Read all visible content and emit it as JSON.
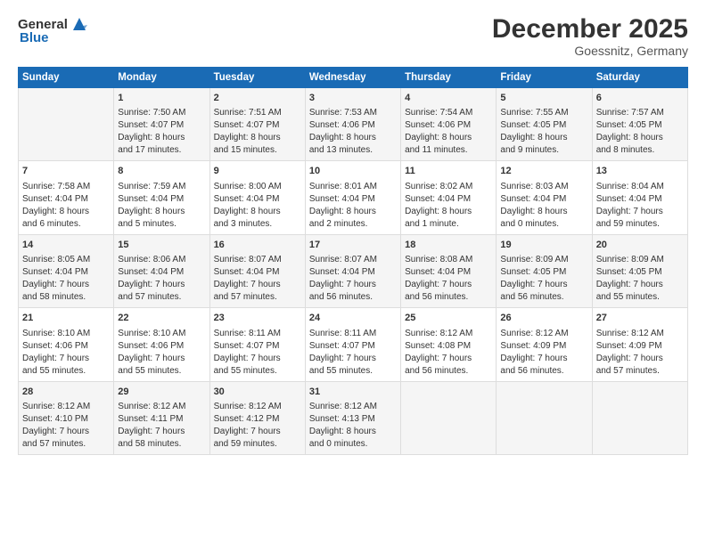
{
  "logo": {
    "general": "General",
    "blue": "Blue"
  },
  "title": "December 2025",
  "subtitle": "Goessnitz, Germany",
  "days_header": [
    "Sunday",
    "Monday",
    "Tuesday",
    "Wednesday",
    "Thursday",
    "Friday",
    "Saturday"
  ],
  "weeks": [
    [
      {
        "day": "",
        "content": ""
      },
      {
        "day": "1",
        "content": "Sunrise: 7:50 AM\nSunset: 4:07 PM\nDaylight: 8 hours\nand 17 minutes."
      },
      {
        "day": "2",
        "content": "Sunrise: 7:51 AM\nSunset: 4:07 PM\nDaylight: 8 hours\nand 15 minutes."
      },
      {
        "day": "3",
        "content": "Sunrise: 7:53 AM\nSunset: 4:06 PM\nDaylight: 8 hours\nand 13 minutes."
      },
      {
        "day": "4",
        "content": "Sunrise: 7:54 AM\nSunset: 4:06 PM\nDaylight: 8 hours\nand 11 minutes."
      },
      {
        "day": "5",
        "content": "Sunrise: 7:55 AM\nSunset: 4:05 PM\nDaylight: 8 hours\nand 9 minutes."
      },
      {
        "day": "6",
        "content": "Sunrise: 7:57 AM\nSunset: 4:05 PM\nDaylight: 8 hours\nand 8 minutes."
      }
    ],
    [
      {
        "day": "7",
        "content": "Sunrise: 7:58 AM\nSunset: 4:04 PM\nDaylight: 8 hours\nand 6 minutes."
      },
      {
        "day": "8",
        "content": "Sunrise: 7:59 AM\nSunset: 4:04 PM\nDaylight: 8 hours\nand 5 minutes."
      },
      {
        "day": "9",
        "content": "Sunrise: 8:00 AM\nSunset: 4:04 PM\nDaylight: 8 hours\nand 3 minutes."
      },
      {
        "day": "10",
        "content": "Sunrise: 8:01 AM\nSunset: 4:04 PM\nDaylight: 8 hours\nand 2 minutes."
      },
      {
        "day": "11",
        "content": "Sunrise: 8:02 AM\nSunset: 4:04 PM\nDaylight: 8 hours\nand 1 minute."
      },
      {
        "day": "12",
        "content": "Sunrise: 8:03 AM\nSunset: 4:04 PM\nDaylight: 8 hours\nand 0 minutes."
      },
      {
        "day": "13",
        "content": "Sunrise: 8:04 AM\nSunset: 4:04 PM\nDaylight: 7 hours\nand 59 minutes."
      }
    ],
    [
      {
        "day": "14",
        "content": "Sunrise: 8:05 AM\nSunset: 4:04 PM\nDaylight: 7 hours\nand 58 minutes."
      },
      {
        "day": "15",
        "content": "Sunrise: 8:06 AM\nSunset: 4:04 PM\nDaylight: 7 hours\nand 57 minutes."
      },
      {
        "day": "16",
        "content": "Sunrise: 8:07 AM\nSunset: 4:04 PM\nDaylight: 7 hours\nand 57 minutes."
      },
      {
        "day": "17",
        "content": "Sunrise: 8:07 AM\nSunset: 4:04 PM\nDaylight: 7 hours\nand 56 minutes."
      },
      {
        "day": "18",
        "content": "Sunrise: 8:08 AM\nSunset: 4:04 PM\nDaylight: 7 hours\nand 56 minutes."
      },
      {
        "day": "19",
        "content": "Sunrise: 8:09 AM\nSunset: 4:05 PM\nDaylight: 7 hours\nand 56 minutes."
      },
      {
        "day": "20",
        "content": "Sunrise: 8:09 AM\nSunset: 4:05 PM\nDaylight: 7 hours\nand 55 minutes."
      }
    ],
    [
      {
        "day": "21",
        "content": "Sunrise: 8:10 AM\nSunset: 4:06 PM\nDaylight: 7 hours\nand 55 minutes."
      },
      {
        "day": "22",
        "content": "Sunrise: 8:10 AM\nSunset: 4:06 PM\nDaylight: 7 hours\nand 55 minutes."
      },
      {
        "day": "23",
        "content": "Sunrise: 8:11 AM\nSunset: 4:07 PM\nDaylight: 7 hours\nand 55 minutes."
      },
      {
        "day": "24",
        "content": "Sunrise: 8:11 AM\nSunset: 4:07 PM\nDaylight: 7 hours\nand 55 minutes."
      },
      {
        "day": "25",
        "content": "Sunrise: 8:12 AM\nSunset: 4:08 PM\nDaylight: 7 hours\nand 56 minutes."
      },
      {
        "day": "26",
        "content": "Sunrise: 8:12 AM\nSunset: 4:09 PM\nDaylight: 7 hours\nand 56 minutes."
      },
      {
        "day": "27",
        "content": "Sunrise: 8:12 AM\nSunset: 4:09 PM\nDaylight: 7 hours\nand 57 minutes."
      }
    ],
    [
      {
        "day": "28",
        "content": "Sunrise: 8:12 AM\nSunset: 4:10 PM\nDaylight: 7 hours\nand 57 minutes."
      },
      {
        "day": "29",
        "content": "Sunrise: 8:12 AM\nSunset: 4:11 PM\nDaylight: 7 hours\nand 58 minutes."
      },
      {
        "day": "30",
        "content": "Sunrise: 8:12 AM\nSunset: 4:12 PM\nDaylight: 7 hours\nand 59 minutes."
      },
      {
        "day": "31",
        "content": "Sunrise: 8:12 AM\nSunset: 4:13 PM\nDaylight: 8 hours\nand 0 minutes."
      },
      {
        "day": "",
        "content": ""
      },
      {
        "day": "",
        "content": ""
      },
      {
        "day": "",
        "content": ""
      }
    ]
  ]
}
